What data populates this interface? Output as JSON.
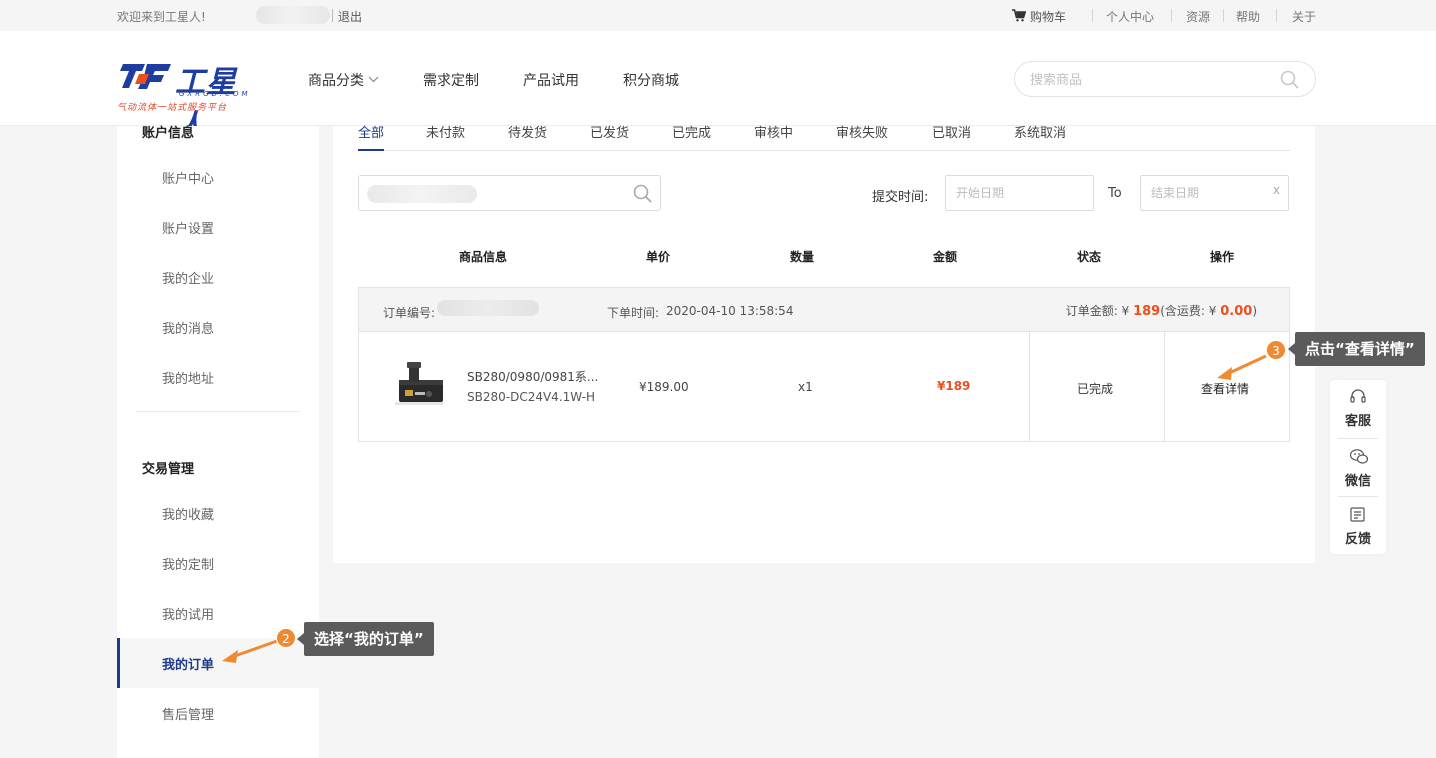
{
  "topbar": {
    "welcome": "欢迎来到工星人!",
    "logout": "退出",
    "cart": "购物车",
    "links": [
      "个人中心",
      "资源",
      "帮助",
      "关于"
    ]
  },
  "header": {
    "logo": {
      "brand": "工星人",
      "domain": "GXRGD.COM",
      "slogan": "气动流体一站式服务平台"
    },
    "nav": [
      "商品分类",
      "需求定制",
      "产品试用",
      "积分商城"
    ],
    "search_placeholder": "搜索商品"
  },
  "sidebar": {
    "section_account": "账户信息",
    "account_items": [
      "账户中心",
      "账户设置",
      "我的企业",
      "我的消息",
      "我的地址"
    ],
    "section_trade": "交易管理",
    "trade_items": [
      "我的收藏",
      "我的定制",
      "我的试用",
      "我的订单",
      "售后管理"
    ],
    "active_item": "我的订单"
  },
  "tabs": [
    "全部",
    "未付款",
    "待发货",
    "已发货",
    "已完成",
    "审核中",
    "审核失败",
    "已取消",
    "系统取消"
  ],
  "active_tab": "全部",
  "filters": {
    "date_label": "提交时间:",
    "start_placeholder": "开始日期",
    "to_label": "To",
    "end_placeholder": "结束日期",
    "clear": "x"
  },
  "table_headers": [
    "商品信息",
    "单价",
    "数量",
    "金额",
    "状态",
    "操作"
  ],
  "order": {
    "number_label": "订单编号:",
    "time_label": "下单时间:",
    "time_value": "2020-04-10 13:58:54",
    "total_prefix": "订单金额:  ¥ ",
    "total_value": "189",
    "shipping_prefix": "(含运费:  ¥ ",
    "shipping_value": "0.00",
    "shipping_suffix": ")",
    "product_name": "SB280/0980/0981系...",
    "product_model": "SB280-DC24V4.1W-H",
    "unit_price": "¥189.00",
    "quantity": "x1",
    "amount": "¥189",
    "status": "已完成",
    "action": "查看详情"
  },
  "floatbar": [
    "客服",
    "微信",
    "反馈"
  ],
  "annotations": {
    "step2_number": "2",
    "step2_text": "选择“我的订单”",
    "step3_number": "3",
    "step3_text": "点击“查看详情”"
  },
  "colors": {
    "brand_blue": "#1f3a8a",
    "price_orange": "#e8511f",
    "annotation_orange": "#ef8a33",
    "callout_gray": "#5b5b5b"
  }
}
